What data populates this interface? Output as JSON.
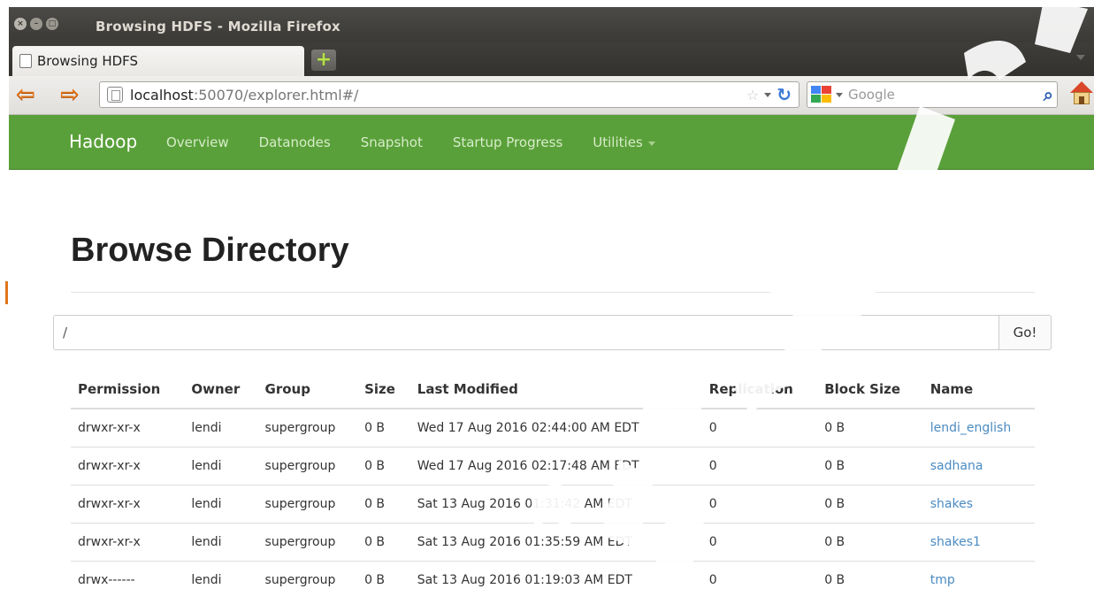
{
  "window": {
    "title": "Browsing HDFS - Mozilla Firefox"
  },
  "tab": {
    "label": "Browsing HDFS"
  },
  "urlbar": {
    "host": "localhost",
    "rest": ":50070/explorer.html#/"
  },
  "searchbar": {
    "placeholder": "Google"
  },
  "hadoop_nav": {
    "brand": "Hadoop",
    "items": [
      "Overview",
      "Datanodes",
      "Snapshot",
      "Startup Progress",
      "Utilities"
    ]
  },
  "page": {
    "title": "Browse Directory",
    "path_value": "/",
    "go_label": "Go!"
  },
  "table": {
    "headers": [
      "Permission",
      "Owner",
      "Group",
      "Size",
      "Last Modified",
      "Replication",
      "Block Size",
      "Name"
    ],
    "rows": [
      [
        "drwxr-xr-x",
        "lendi",
        "supergroup",
        "0 B",
        "Wed 17 Aug 2016 02:44:00 AM EDT",
        "0",
        "0 B",
        "lendi_english"
      ],
      [
        "drwxr-xr-x",
        "lendi",
        "supergroup",
        "0 B",
        "Wed 17 Aug 2016 02:17:48 AM EDT",
        "0",
        "0 B",
        "sadhana"
      ],
      [
        "drwxr-xr-x",
        "lendi",
        "supergroup",
        "0 B",
        "Sat 13 Aug 2016 01:31:42 AM EDT",
        "0",
        "0 B",
        "shakes"
      ],
      [
        "drwxr-xr-x",
        "lendi",
        "supergroup",
        "0 B",
        "Sat 13 Aug 2016 01:35:59 AM EDT",
        "0",
        "0 B",
        "shakes1"
      ],
      [
        "drwx------",
        "lendi",
        "supergroup",
        "0 B",
        "Sat 13 Aug 2016 01:19:03 AM EDT",
        "0",
        "0 B",
        "tmp"
      ]
    ]
  },
  "colors": {
    "hadoop_green": "#5aa03a",
    "link_blue": "#4a8bc2",
    "firefox_orange": "#e8761a"
  }
}
